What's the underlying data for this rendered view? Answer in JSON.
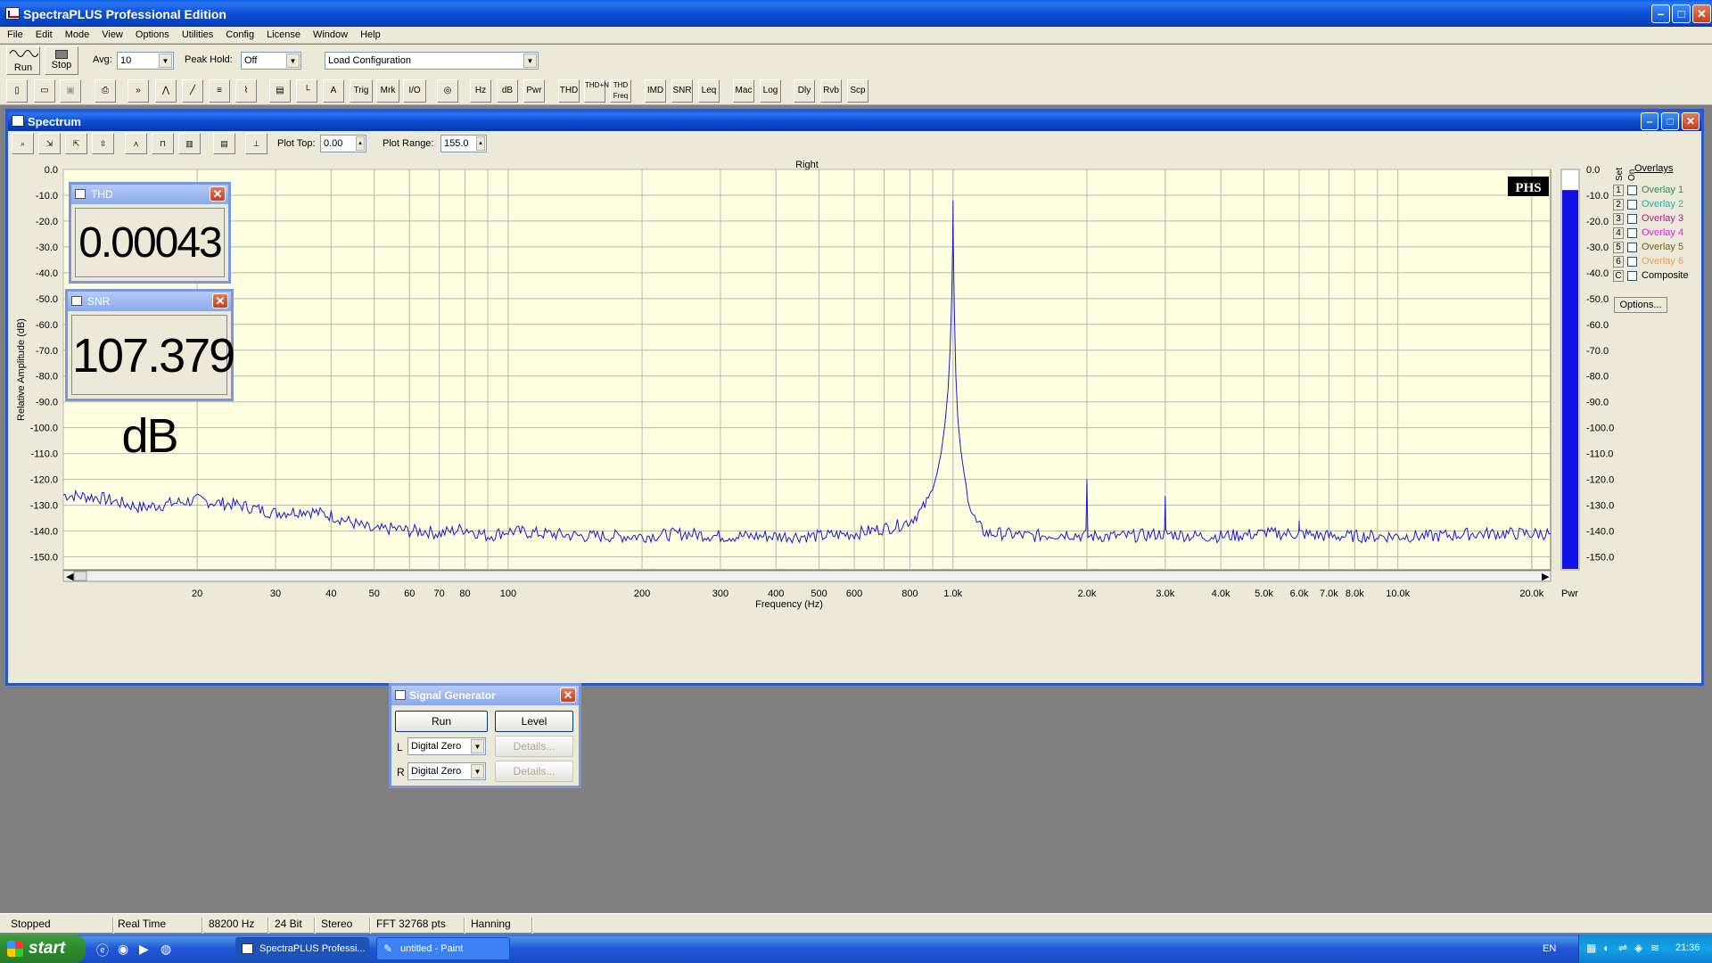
{
  "app": {
    "title": "SpectraPLUS Professional Edition",
    "menu": [
      "File",
      "Edit",
      "Mode",
      "View",
      "Options",
      "Utilities",
      "Config",
      "License",
      "Window",
      "Help"
    ]
  },
  "toolbar": {
    "run_label": "Run",
    "stop_label": "Stop",
    "avg_label": "Avg:",
    "avg_value": "10",
    "peak_hold_label": "Peak Hold:",
    "peak_hold_value": "Off",
    "config_value": "Load Configuration",
    "buttons": [
      "Trig",
      "Mrk",
      "I/O",
      "Hz",
      "dB",
      "Pwr",
      "THD",
      "THD+N",
      "THD Freq",
      "IMD",
      "SNR",
      "Leq",
      "Mac",
      "Log",
      "Dly",
      "Rvb",
      "Scp"
    ]
  },
  "spectrum": {
    "title": "Spectrum",
    "plot_top_label": "Plot Top:",
    "plot_top_value": "0.00",
    "plot_range_label": "Plot Range:",
    "plot_range_value": "155.0",
    "badge": "PHS",
    "pwr_label": "Pwr",
    "overlays": {
      "header": "Overlays",
      "set_label": "Set",
      "on_label": "On",
      "items": [
        {
          "key": "1",
          "label": "Overlay 1",
          "color": "#2e8b57"
        },
        {
          "key": "2",
          "label": "Overlay 2",
          "color": "#20b2aa"
        },
        {
          "key": "3",
          "label": "Overlay 3",
          "color": "#b0208c"
        },
        {
          "key": "4",
          "label": "Overlay 4",
          "color": "#e020e0"
        },
        {
          "key": "5",
          "label": "Overlay 5",
          "color": "#7a5a10"
        },
        {
          "key": "6",
          "label": "Overlay 6",
          "color": "#e8a050"
        },
        {
          "key": "C",
          "label": "Composite",
          "color": "#000000"
        }
      ],
      "options_label": "Options..."
    }
  },
  "meters": {
    "thd": {
      "title": "THD",
      "value": "0.00043 %"
    },
    "snr": {
      "title": "SNR",
      "value": "107.379 dB"
    }
  },
  "signal_generator": {
    "title": "Signal Generator",
    "run_label": "Run",
    "level_label": "Level",
    "left_label": "L",
    "right_label": "R",
    "left_value": "Digital Zero",
    "right_value": "Digital Zero",
    "details_label": "Details..."
  },
  "status": [
    "Stopped",
    "Real Time",
    "88200 Hz",
    "24 Bit",
    "Stereo",
    "FFT 32768 pts",
    "Hanning"
  ],
  "taskbar": {
    "start_label": "start",
    "tasks": [
      "SpectraPLUS Professi...",
      "untitled - Paint"
    ],
    "lang": "EN",
    "clock": "21:36"
  },
  "chart_data": {
    "type": "line",
    "title": "Right",
    "xlabel": "Frequency (Hz)",
    "ylabel": "Relative Amplitude (dB)",
    "xscale": "log",
    "xlim": [
      10,
      22050
    ],
    "ylim": [
      -155,
      0
    ],
    "grid": true,
    "x_tick_labels": [
      "20",
      "30",
      "40",
      "50",
      "60",
      "70",
      "80",
      "100",
      "200",
      "300",
      "400",
      "500",
      "600",
      "800",
      "1.0k",
      "2.0k",
      "3.0k",
      "4.0k",
      "5.0k",
      "6.0k",
      "7.0k",
      "8.0k",
      "10.0k",
      "20.0k"
    ],
    "x_tick_values": [
      20,
      30,
      40,
      50,
      60,
      70,
      80,
      100,
      200,
      300,
      400,
      500,
      600,
      800,
      1000,
      2000,
      3000,
      4000,
      5000,
      6000,
      7000,
      8000,
      10000,
      20000
    ],
    "y_tick_labels": [
      "0.0",
      "-10.0",
      "-20.0",
      "-30.0",
      "-40.0",
      "-50.0",
      "-60.0",
      "-70.0",
      "-80.0",
      "-90.0",
      "-100.0",
      "-110.0",
      "-120.0",
      "-130.0",
      "-140.0",
      "-150.0"
    ],
    "y_tick_values": [
      0,
      -10,
      -20,
      -30,
      -40,
      -50,
      -60,
      -70,
      -80,
      -90,
      -100,
      -110,
      -120,
      -130,
      -140,
      -150
    ],
    "power_bar_level_db": -8,
    "series": [
      {
        "name": "Right",
        "color": "#1a1adc",
        "x": [
          10,
          12,
          15,
          18,
          20,
          22,
          25,
          28,
          30,
          35,
          40,
          45,
          50,
          55,
          60,
          65,
          70,
          80,
          90,
          100,
          120,
          150,
          200,
          250,
          300,
          400,
          500,
          600,
          700,
          750,
          800,
          850,
          880,
          900,
          920,
          940,
          960,
          975,
          985,
          993,
          998,
          1000,
          1002,
          1007,
          1015,
          1025,
          1040,
          1060,
          1080,
          1100,
          1130,
          1170,
          1200,
          1300,
          1500,
          1800,
          1990,
          2000,
          2010,
          2500,
          2990,
          3000,
          3010,
          3500,
          4000,
          4990,
          5000,
          5010,
          5990,
          6000,
          6010,
          7000,
          8000,
          10000,
          12000,
          15000,
          20000,
          22050
        ],
        "y": [
          -126,
          -127,
          -131,
          -129,
          -128,
          -129,
          -130,
          -132,
          -133,
          -132,
          -134,
          -137,
          -140,
          -139,
          -140,
          -140,
          -141,
          -139,
          -142,
          -140,
          -141,
          -142,
          -142,
          -141,
          -142,
          -142,
          -142,
          -141,
          -139,
          -138,
          -136,
          -132,
          -128,
          -124,
          -118,
          -110,
          -98,
          -85,
          -70,
          -50,
          -30,
          -12,
          -30,
          -55,
          -80,
          -96,
          -108,
          -118,
          -126,
          -132,
          -137,
          -140,
          -141,
          -141,
          -142,
          -141,
          -142,
          -120,
          -142,
          -142,
          -141,
          -128,
          -141,
          -142,
          -142,
          -141,
          -138,
          -141,
          -141,
          -137,
          -141,
          -142,
          -142,
          -142,
          -142,
          -141,
          -141,
          -141
        ]
      }
    ]
  }
}
